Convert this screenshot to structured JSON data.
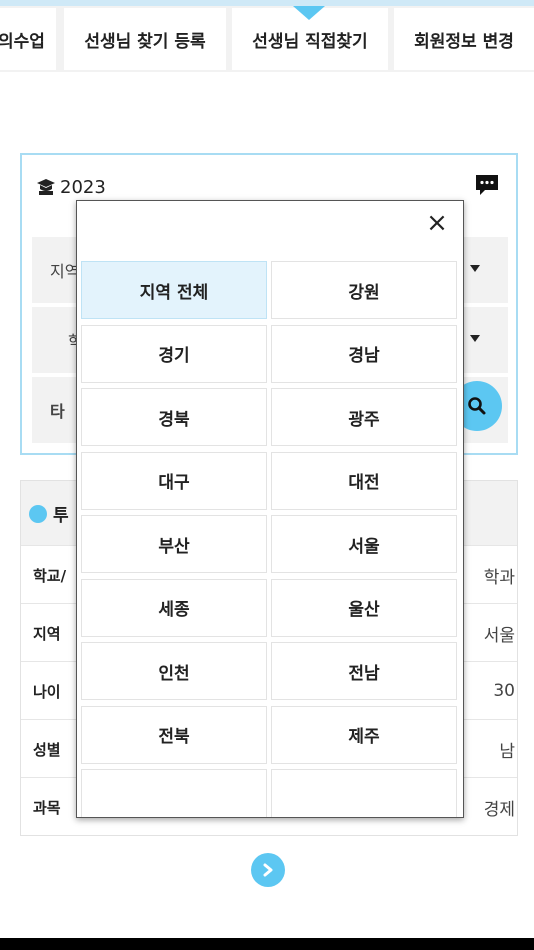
{
  "tabs": [
    "의수업",
    "선생님 찾기 등록",
    "선생님 직접찾기",
    "회원정보 변경"
  ],
  "search": {
    "year": "2023",
    "region_label": "지역",
    "school_label": "학",
    "type_label": "타"
  },
  "result": {
    "title": "투",
    "rows": [
      {
        "key": "학교/",
        "value": "학과"
      },
      {
        "key": "지역",
        "value": "서울"
      },
      {
        "key": "나이",
        "value": "30"
      },
      {
        "key": "성별",
        "value": "남"
      },
      {
        "key": "과목",
        "value": "경제"
      }
    ]
  },
  "modal": {
    "close": "×",
    "regions": [
      "지역 전체",
      "강원",
      "경기",
      "경남",
      "경북",
      "광주",
      "대구",
      "대전",
      "부산",
      "서울",
      "세종",
      "울산",
      "인천",
      "전남",
      "전북",
      "제주",
      "",
      ""
    ],
    "selected_index": 0
  },
  "colors": {
    "accent": "#5cc7f2",
    "selected_bg": "#e3f3fc"
  },
  "icons": {
    "year": "graduation-cap-icon",
    "chat": "chat-icon",
    "search": "search-icon",
    "next": "chevron-right-icon",
    "close": "close-icon"
  }
}
